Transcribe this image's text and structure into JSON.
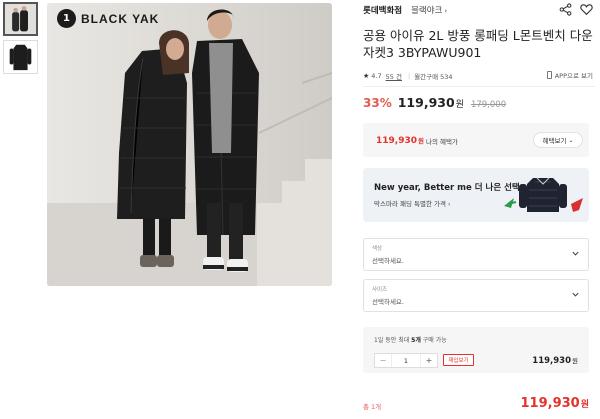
{
  "gallery": {
    "brand_logo_text": "BLACK YAK",
    "brand_logo_mark": "1"
  },
  "store": {
    "name": "롯데백화점",
    "brand": "블랙야크",
    "brand_chevron": "›"
  },
  "product": {
    "title": "공용 아이유 2L 방풍 롱패딩 L몬트벤치 다운자켓3 3BYPAWU901",
    "rating": "4.7",
    "reviews": "55 건",
    "monthly_sales": "월간구매 534",
    "app_link": "APP으로 보기"
  },
  "pricing": {
    "discount": "33%",
    "price": "119,930",
    "won": "원",
    "original_price": "179,000"
  },
  "benefit": {
    "price": "119,930",
    "won": "원",
    "label": "나의 혜택가",
    "button_label": "혜택보기",
    "button_chevron": "⌄"
  },
  "banner": {
    "title": "New year, Better me 더 나은 선택",
    "subtitle": "막스마라 패딩 특별한 가격",
    "chevron": "›"
  },
  "options": [
    {
      "label": "색상",
      "value": "선택하세요."
    },
    {
      "label": "사이즈",
      "value": "선택하세요."
    }
  ],
  "quantity": {
    "limit_prefix": "1일 동안 최대",
    "limit_count": "5개",
    "limit_suffix": "구매 가능",
    "minus": "−",
    "value": "1",
    "plus": "+",
    "stock_button": "재입보기",
    "price": "119,930",
    "won": "원"
  },
  "total": {
    "label": "총 1개",
    "price": "119,930",
    "won": "원"
  },
  "colors": {
    "accent_red": "#e4322c",
    "discount_red": "#e35a50",
    "banner_bg": "#eef1f6"
  },
  "icons": [
    "share-icon",
    "heart-icon",
    "star-icon",
    "phone-icon",
    "chevron-down-icon"
  ]
}
